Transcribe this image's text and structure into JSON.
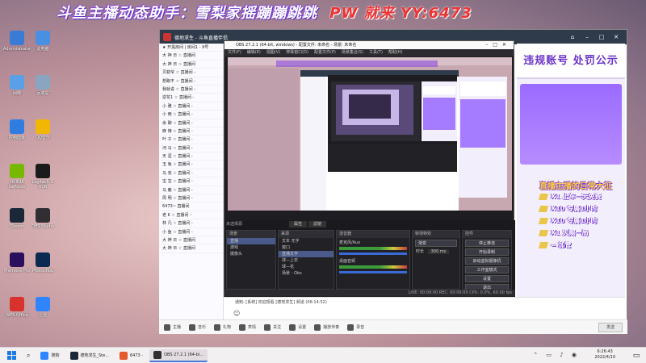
{
  "banner": {
    "text": "斗鱼主播动态助手：雪梨家摇蹦蹦跳跳",
    "yy": "PW 就来 YY:6473"
  },
  "desktop_icons": [
    {
      "label": "Administrator",
      "color": "#3a7bd5"
    },
    {
      "label": "此电脑",
      "color": "#4a90e2"
    },
    {
      "label": "网络",
      "color": "#5aa0e8"
    },
    {
      "label": "回收站",
      "color": "#8aa5c0"
    },
    {
      "label": "控制面板",
      "color": "#2f7de1"
    },
    {
      "label": "QQ音乐",
      "color": "#f2b705"
    },
    {
      "label": "NVIDIA GeForce",
      "color": "#76b900"
    },
    {
      "label": "Logitech G HUB",
      "color": "#1b1b1b"
    },
    {
      "label": "Steam",
      "color": "#1b2838"
    },
    {
      "label": "OBS Studio",
      "color": "#302e31"
    },
    {
      "label": "Premiere Pro",
      "color": "#2a0f5c"
    },
    {
      "label": "Photoshop",
      "color": "#0a2a52"
    },
    {
      "label": "WPS Office",
      "color": "#d8322c"
    },
    {
      "label": "迅雷",
      "color": "#2f84ff"
    }
  ],
  "window": {
    "title": "德地求生 - 斗鱼直播伴侣"
  },
  "chatlist": [
    "★ 开黑房间 | 房间1 - 9号",
    "大 神 日 ☆ 直播间",
    "大 神 日 ☆ 直播间",
    "贝勒爷 ☆ 直播间 -",
    "想跑不 ☆ 直播间 -",
    "我就说 ☆ 直播间 -",
    "逆花1 ☆ 直播间 -",
    "小 雅 ☆ 直播间 -",
    "小 雨 ☆ 直播间 -",
    "余 聊 ☆ 直播间 -",
    "麻 辣 ☆ 直播间 -",
    "叶 子 ☆ 直播间 -",
    "河 马 ☆ 直播间 -",
    "天 涯 ☆ 直播间 -",
    "玉 兔 ☆ 直播间 -",
    "马 克 ☆ 直播间 -",
    "宝 宝 ☆ 直播间 -",
    "马 鹿 ☆ 直播间 -",
    "周 明 ☆ 直播间 -",
    "6473~ 直播间",
    "老 K ☆ 直播间 -",
    "林 凡 ☆ 直播间 -",
    "小 鱼 ☆ 直播间 -",
    "大 神 日 ☆ 直播间",
    "大 神 日 ☆ 直播间"
  ],
  "obs": {
    "title": "OBS 27.2.1 (64-bit, windows) - 配置文件: 未命名 - 场景: 未命名",
    "menu": [
      "文件(F)",
      "编辑(E)",
      "视图(V)",
      "停靠窗口(D)",
      "配置文件(P)",
      "场景集合(S)",
      "工具(T)",
      "帮助(H)"
    ],
    "no_source": "未选择源",
    "props": "属性",
    "filters": "滤镜",
    "docks": {
      "scenes": {
        "title": "场景",
        "items": [
          "直播",
          "游戏",
          "摄像头"
        ]
      },
      "sources": {
        "title": "来源",
        "items": [
          "文本 无字",
          "窗口",
          "直播文字",
          "球—上衣",
          "球—花",
          "场景 - Obs"
        ]
      },
      "mixer": {
        "title": "混音器",
        "tracks": [
          {
            "name": "麦克风/Aux",
            "db": "0.0 dB"
          },
          {
            "name": "桌面音频",
            "db": "-1.7 dB"
          }
        ]
      },
      "transitions": {
        "title": "转场特效",
        "type": "渐变",
        "duration_label": "时长",
        "duration": "300 ms"
      },
      "controls": {
        "title": "控件",
        "buttons": [
          "停止推流",
          "开始录制",
          "启动虚拟摄像机",
          "工作室模式",
          "设置",
          "退出"
        ]
      }
    },
    "status": "LIVE: 00:00:00   REC: 00:00:00   CPU: 0.0%, 60.00 fps"
  },
  "rightpanel": {
    "title": "违规账号 处罚公示",
    "notice": "直播主播的日常大征",
    "lines": [
      "X1 上车一天免费",
      "X10 专属1小时",
      "X10 专属1小时",
      "X1 天赐一局",
      "= 加管"
    ]
  },
  "chat_input": {
    "notice": "通知: [系统] 欢迎观看 [德地求生] 频道 (06:14:52)"
  },
  "bottombar": {
    "items": [
      "主播",
      "音乐",
      "礼物",
      "表情",
      "关注",
      "设置",
      "播放伴奏",
      "录音"
    ],
    "send": "发送"
  },
  "taskbar": {
    "tasks": [
      {
        "label": "搜狗",
        "color": "#2f84ff",
        "active": false
      },
      {
        "label": "德地求生_Ste...",
        "color": "#1b2838",
        "active": false
      },
      {
        "label": "6473 -",
        "color": "#e45a2e",
        "active": false
      },
      {
        "label": "OBS 27.2.1 (64-bi...",
        "color": "#302e31",
        "active": true
      }
    ],
    "time": "6:26:43",
    "date": "2022/4/10"
  }
}
